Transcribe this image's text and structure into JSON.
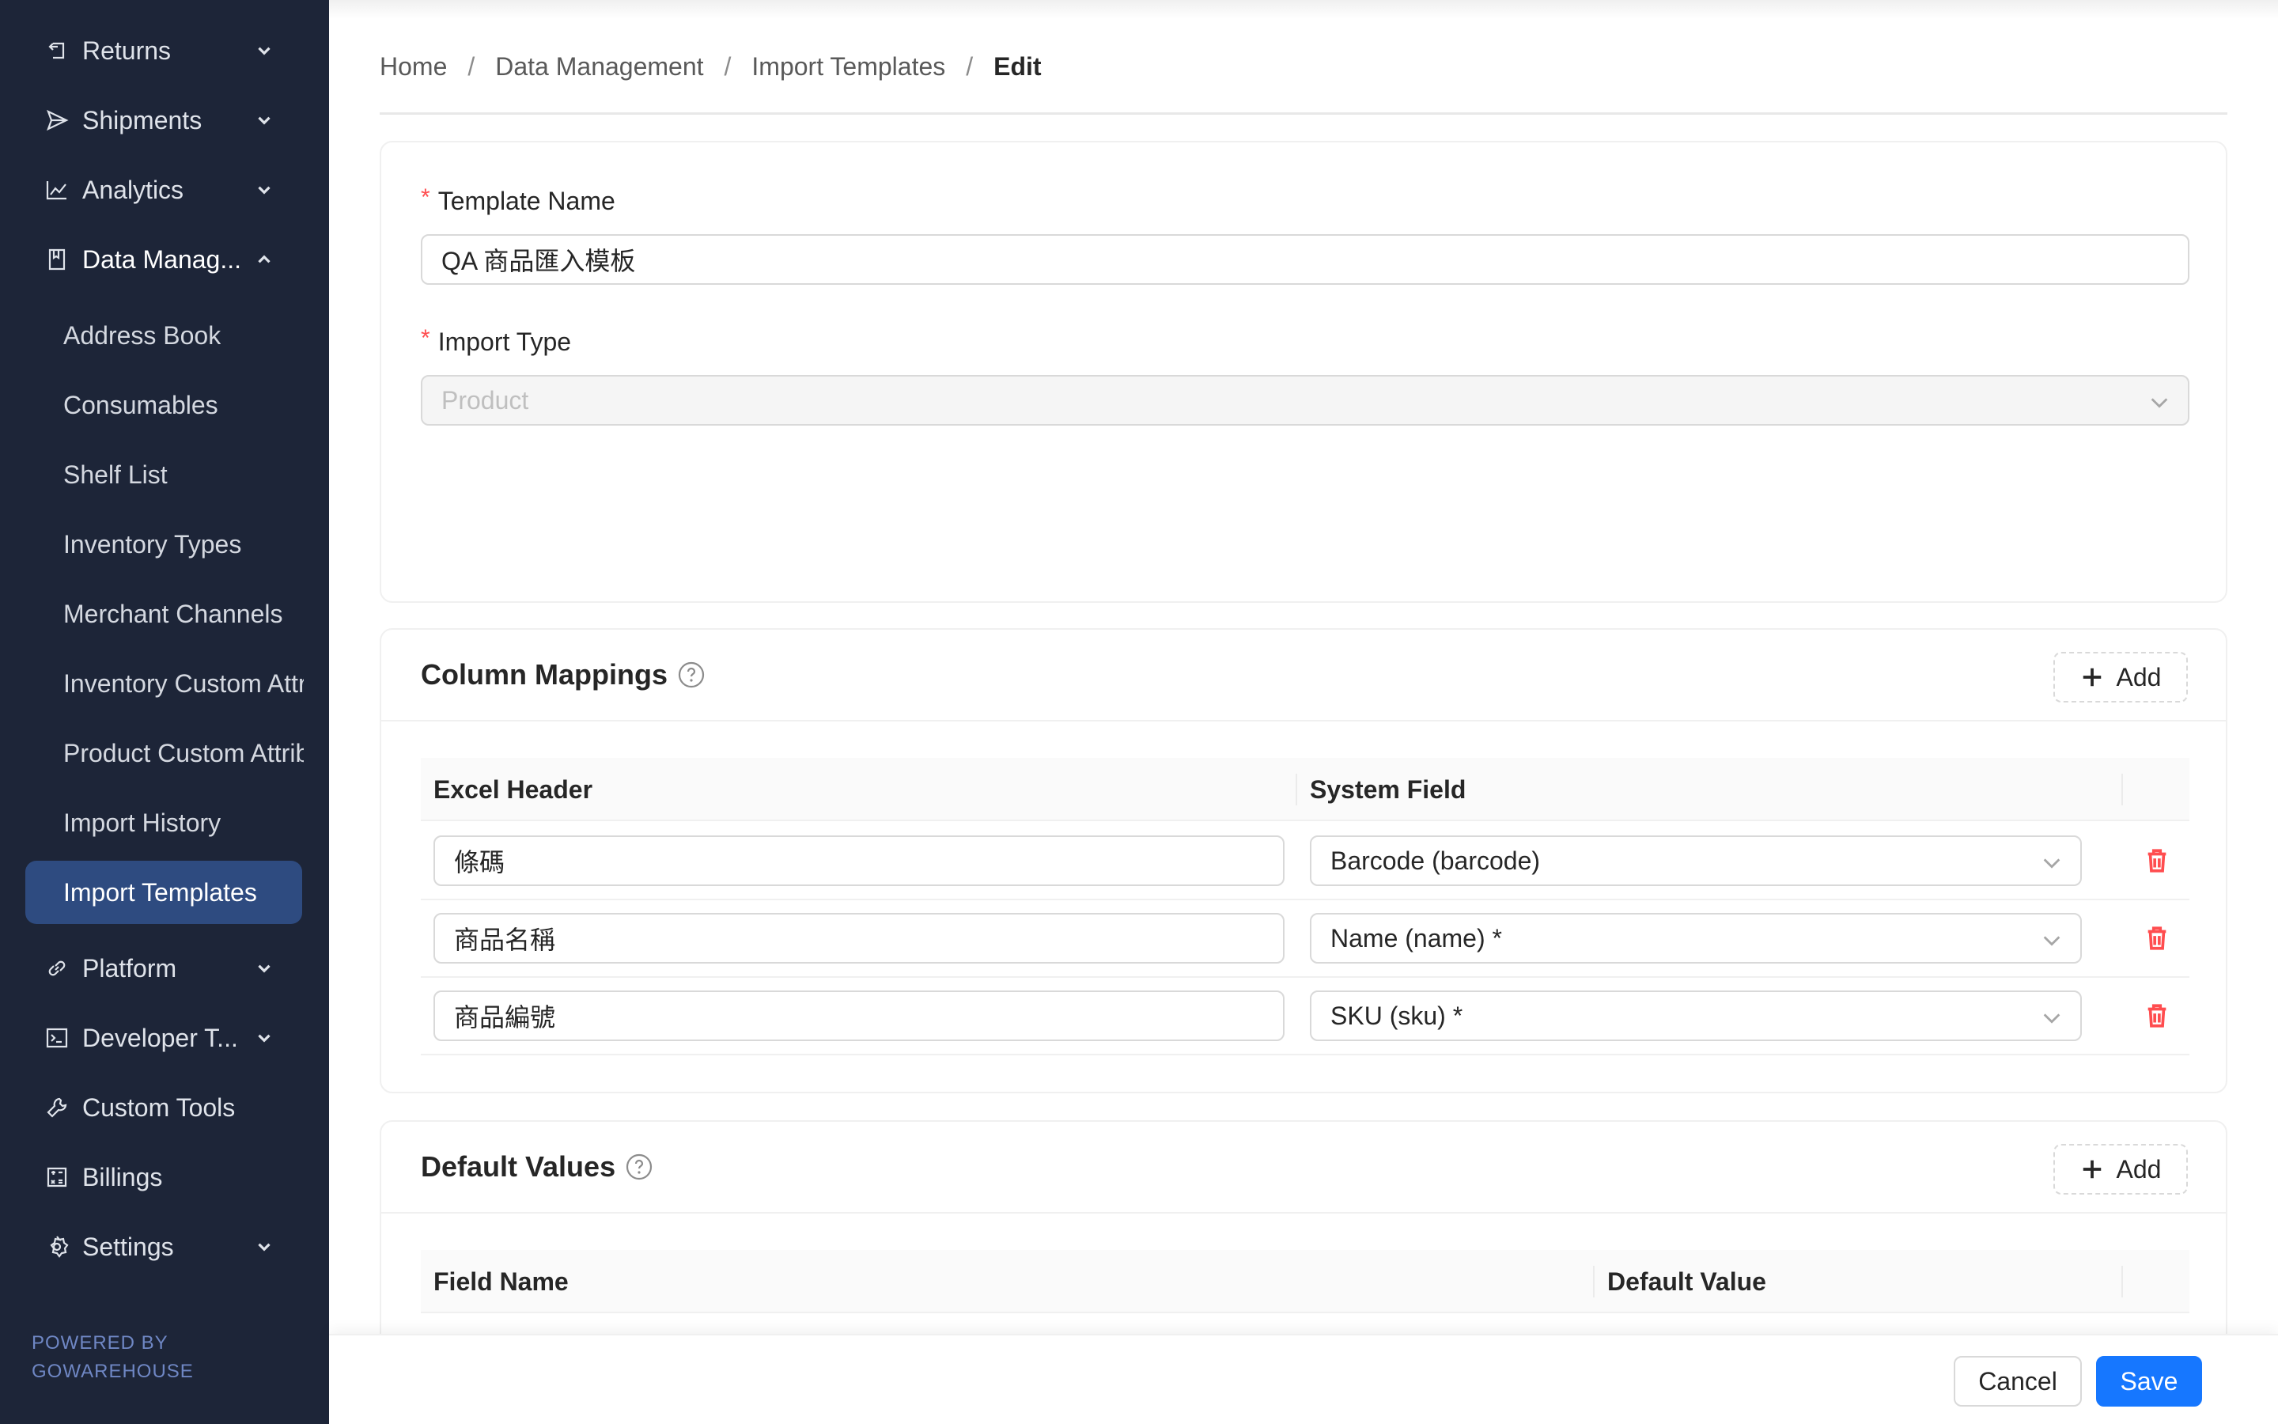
{
  "sidebar": {
    "items": [
      {
        "label": "Returns",
        "icon": "return-icon"
      },
      {
        "label": "Shipments",
        "icon": "send-icon"
      },
      {
        "label": "Analytics",
        "icon": "line-chart-icon"
      },
      {
        "label": "Data Manag...",
        "icon": "book-icon"
      },
      {
        "label": "Platform",
        "icon": "link-icon"
      },
      {
        "label": "Developer T...",
        "icon": "terminal-icon"
      },
      {
        "label": "Custom Tools",
        "icon": "wrench-icon"
      },
      {
        "label": "Billings",
        "icon": "calculator-icon"
      },
      {
        "label": "Settings",
        "icon": "gear-icon"
      }
    ],
    "sub_items": [
      {
        "label": "Address Book"
      },
      {
        "label": "Consumables"
      },
      {
        "label": "Shelf List"
      },
      {
        "label": "Inventory Types"
      },
      {
        "label": "Merchant Channels"
      },
      {
        "label": "Inventory Custom Attributes"
      },
      {
        "label": "Product Custom Attributes"
      },
      {
        "label": "Import History"
      },
      {
        "label": "Import Templates"
      }
    ],
    "powered_by": {
      "line1": "POWERED BY",
      "line2": "GOWAREHOUSE"
    }
  },
  "breadcrumb": {
    "items": [
      "Home",
      "Data Management",
      "Import Templates"
    ],
    "current": "Edit",
    "separator": "/"
  },
  "form": {
    "template_name_label": "Template Name",
    "template_name_value": "QA 商品匯入模板",
    "import_type_label": "Import Type",
    "import_type_value": "Product",
    "required_mark": "*"
  },
  "column_mappings": {
    "title": "Column Mappings",
    "add_label": "Add",
    "headers": {
      "excel": "Excel Header",
      "system": "System Field"
    },
    "rows": [
      {
        "excel": "條碼",
        "system": "Barcode (barcode)"
      },
      {
        "excel": "商品名稱",
        "system": "Name (name) *"
      },
      {
        "excel": "商品編號",
        "system": "SKU (sku) *"
      }
    ]
  },
  "default_values": {
    "title": "Default Values",
    "add_label": "Add",
    "headers": {
      "field": "Field Name",
      "value": "Default Value"
    }
  },
  "footer": {
    "cancel_label": "Cancel",
    "save_label": "Save"
  },
  "colors": {
    "sidebar_bg": "#1d2538",
    "active_item_bg": "#2e4b80",
    "primary": "#1677ff",
    "danger": "#ff4d4f",
    "required": "#ff4d4f",
    "powered_by": "#6f87c4"
  }
}
